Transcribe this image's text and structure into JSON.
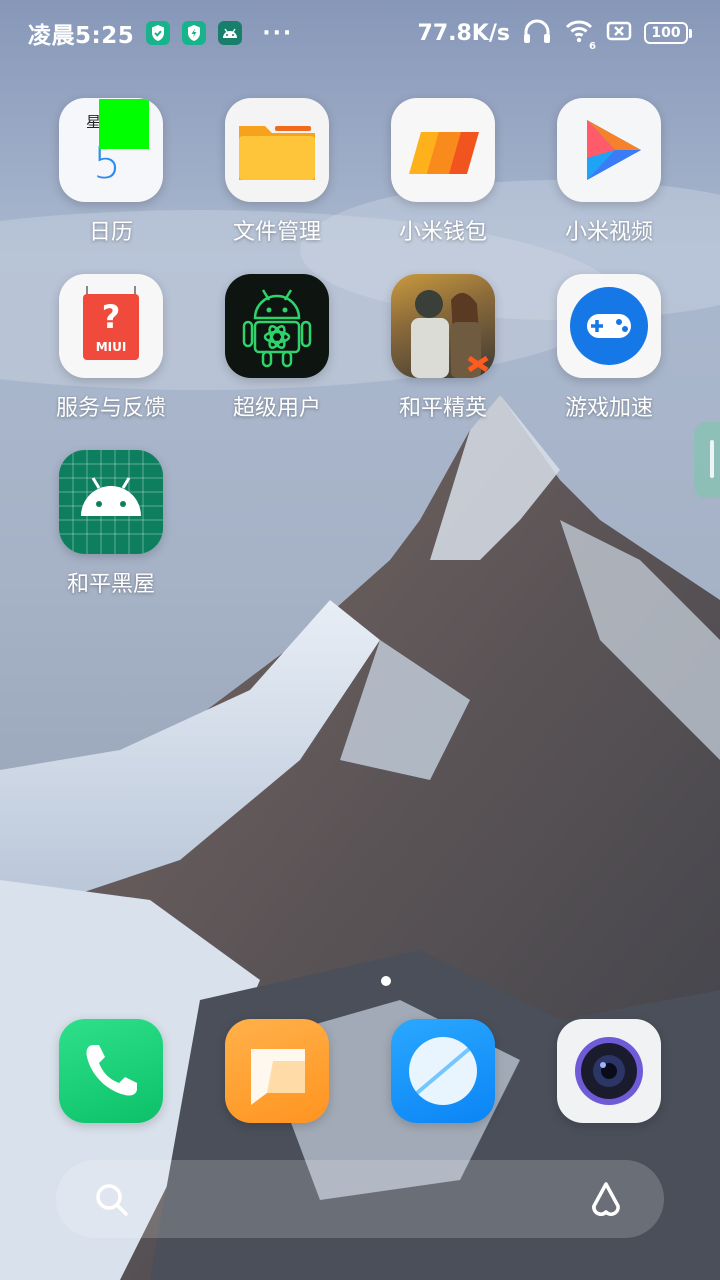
{
  "status_bar": {
    "time": "凌晨5:25",
    "more": "···",
    "net_speed": "77.8K/s",
    "wifi_badge": "6",
    "battery": "100",
    "icons": [
      "shield-icon",
      "shield-bolt-icon",
      "android-icon",
      "headphones-icon",
      "wifi-icon",
      "sim-none-icon",
      "battery-icon"
    ]
  },
  "apps": [
    {
      "label": "日历",
      "icon": "calendar-icon",
      "calendar_weekday": "星",
      "calendar_day": "5"
    },
    {
      "label": "文件管理",
      "icon": "folder-icon"
    },
    {
      "label": "小米钱包",
      "icon": "wallet-icon"
    },
    {
      "label": "小米视频",
      "icon": "video-play-icon"
    },
    {
      "label": "服务与反馈",
      "icon": "feedback-icon",
      "badge_text": "MIUI",
      "badge_glyph": "?"
    },
    {
      "label": "超级用户",
      "icon": "android-atom-icon"
    },
    {
      "label": "和平精英",
      "icon": "game-art-icon"
    },
    {
      "label": "游戏加速",
      "icon": "gamepad-icon"
    },
    {
      "label": "和平黑屋",
      "icon": "android-grid-icon"
    }
  ],
  "dock": [
    {
      "icon": "phone-icon"
    },
    {
      "icon": "messages-icon"
    },
    {
      "icon": "browser-icon"
    },
    {
      "icon": "camera-icon"
    }
  ],
  "search": {
    "icons": [
      "search-icon",
      "assistant-icon"
    ]
  },
  "colors": {
    "status_badge_green": "#17b38a",
    "marker_green": "#00ff00"
  }
}
